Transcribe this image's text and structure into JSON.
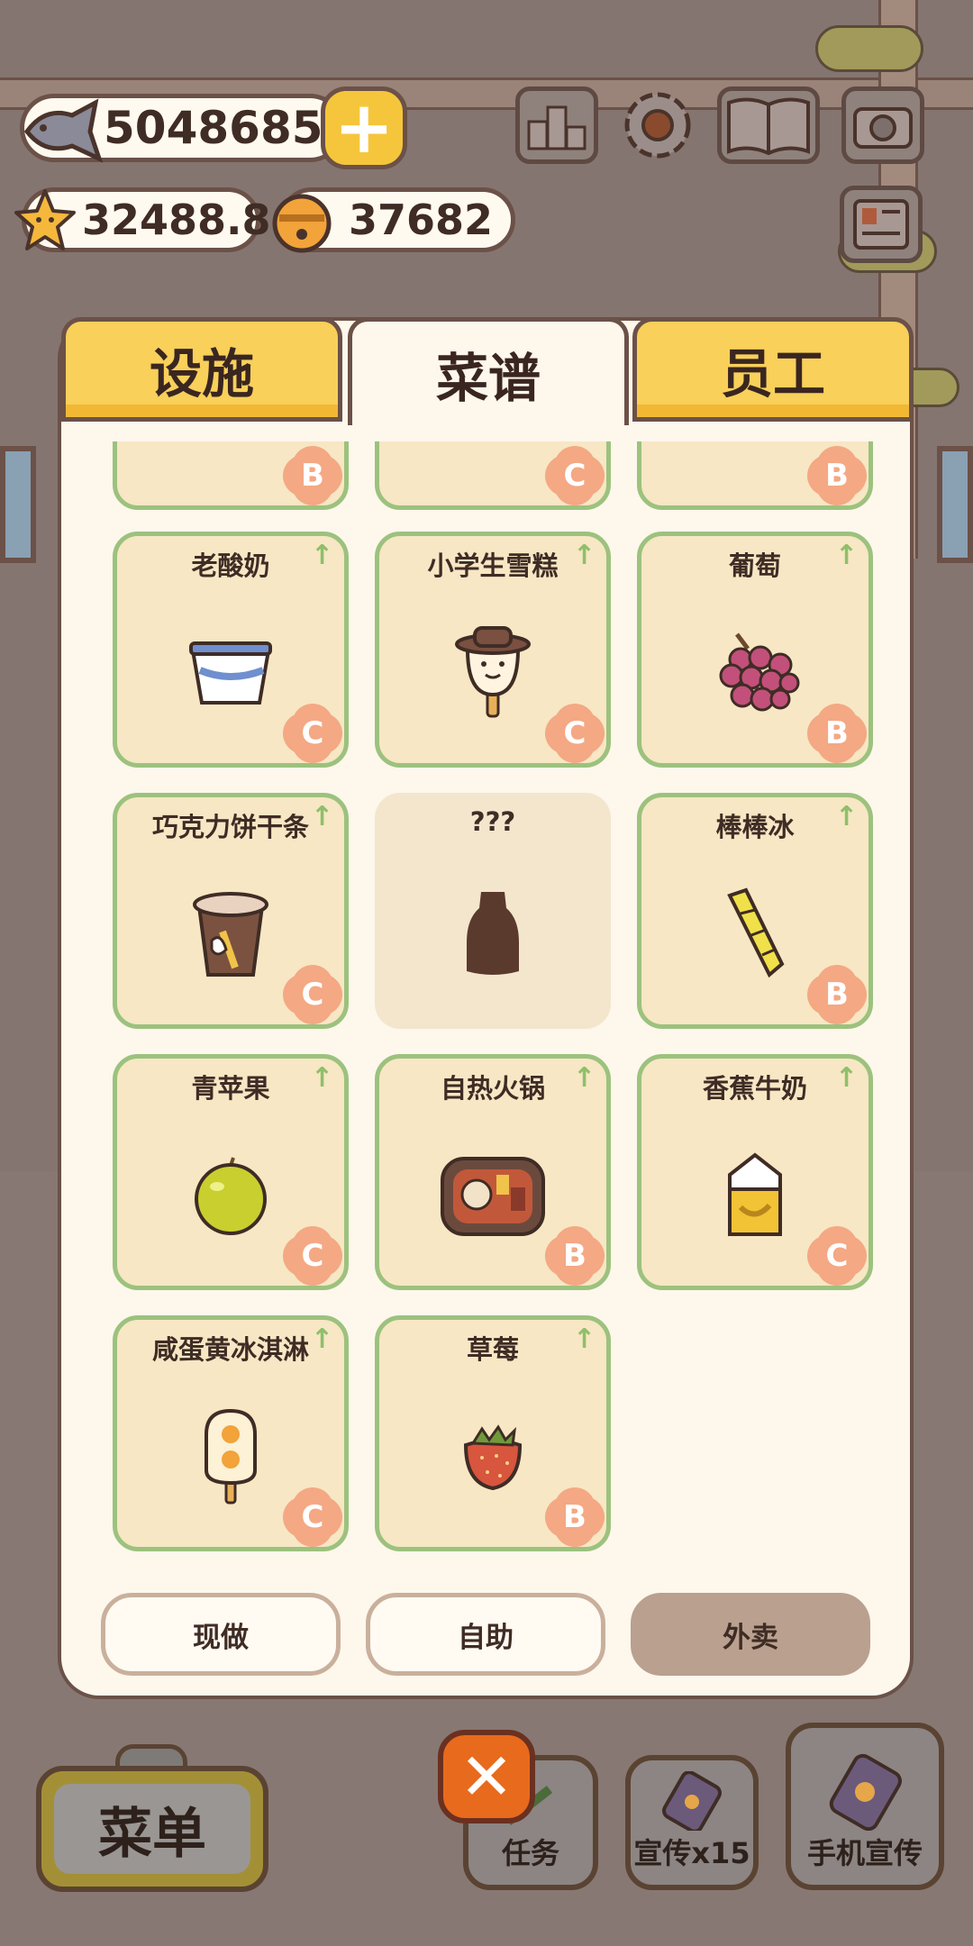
{
  "hud": {
    "fish_count": "5048685",
    "star_count": "32488.8",
    "bell_count": "37682",
    "icons": [
      "fish-icon",
      "plus-icon",
      "star-icon",
      "bell-icon",
      "ranking-icon",
      "gear-icon",
      "recipe-book-icon",
      "camera-icon",
      "newspaper-icon"
    ]
  },
  "tabs": [
    {
      "label": "设施",
      "active": false
    },
    {
      "label": "菜谱",
      "active": true
    },
    {
      "label": "员工",
      "active": false
    }
  ],
  "recipes": {
    "partial_row": [
      {
        "grade": "B"
      },
      {
        "grade": "C"
      },
      {
        "grade": "B"
      }
    ],
    "items": [
      {
        "name": "老酸奶",
        "grade": "C",
        "icon": "yogurt-icon"
      },
      {
        "name": "小学生雪糕",
        "grade": "C",
        "icon": "popsicle-face-icon"
      },
      {
        "name": "葡萄",
        "grade": "B",
        "icon": "grape-icon"
      },
      {
        "name": "巧克力饼干条",
        "grade": "C",
        "icon": "chocolate-stick-icon"
      },
      {
        "name": "???",
        "grade": "",
        "icon": "locked-silhouette-icon"
      },
      {
        "name": "棒棒冰",
        "grade": "B",
        "icon": "ice-pop-icon"
      },
      {
        "name": "青苹果",
        "grade": "C",
        "icon": "green-apple-icon"
      },
      {
        "name": "自热火锅",
        "grade": "B",
        "icon": "hotpot-icon"
      },
      {
        "name": "香蕉牛奶",
        "grade": "C",
        "icon": "banana-milk-icon"
      },
      {
        "name": "咸蛋黄冰淇淋",
        "grade": "C",
        "icon": "egg-yolk-icecream-icon"
      },
      {
        "name": "草莓",
        "grade": "B",
        "icon": "strawberry-icon"
      }
    ]
  },
  "filters": [
    {
      "label": "现做",
      "active": false
    },
    {
      "label": "自助",
      "active": false
    },
    {
      "label": "外卖",
      "active": true
    }
  ],
  "bottom_bar": {
    "menu_label": "菜单",
    "task_label": "任务",
    "promo_label": "宣传x15",
    "phone_promo_label": "手机宣传"
  },
  "colors": {
    "tab_yellow": "#f8d05a",
    "card_border": "#9cc27e",
    "grade_badge": "#f4a884",
    "close_button": "#e86a1c"
  }
}
